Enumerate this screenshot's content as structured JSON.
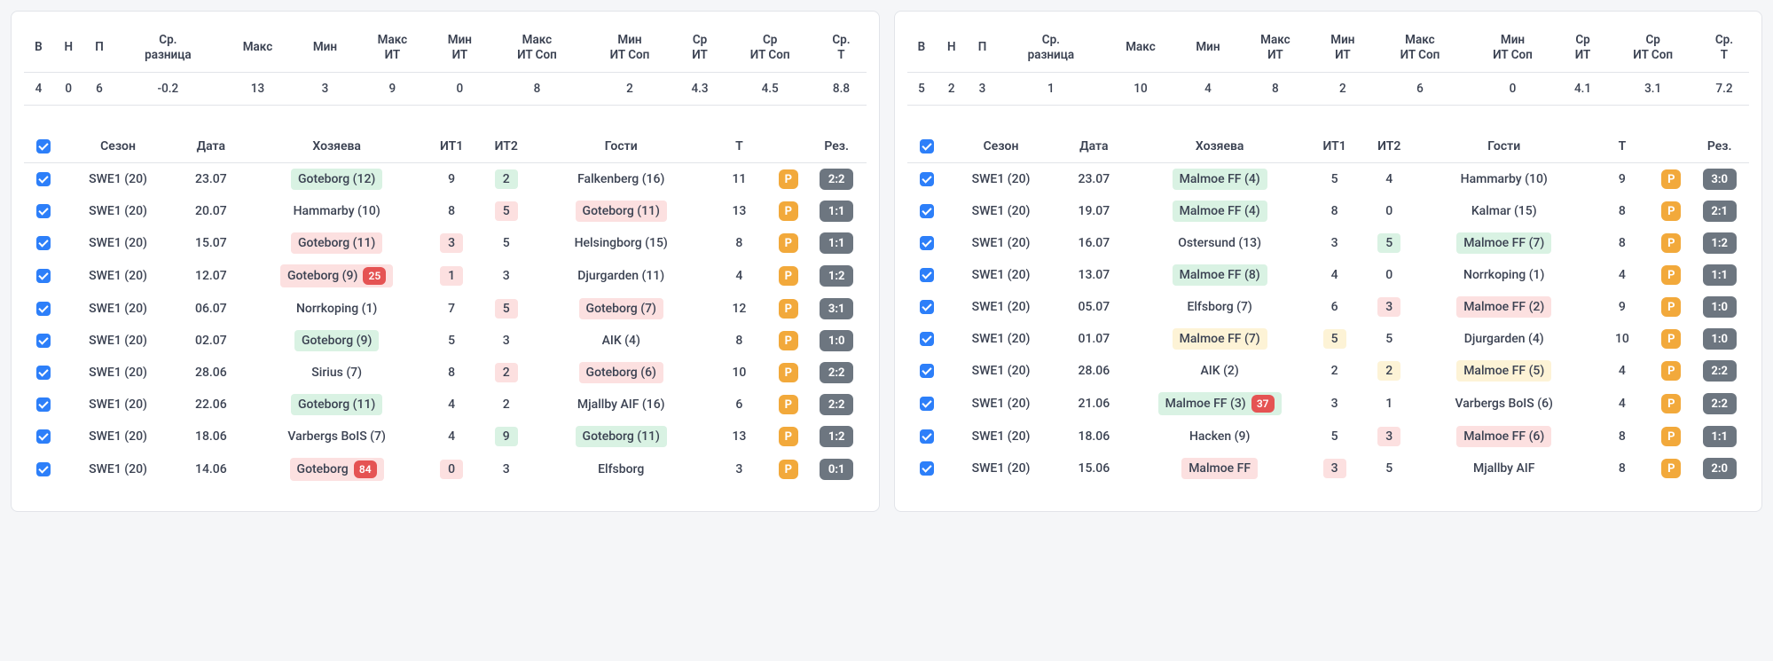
{
  "summary_headers": [
    "В",
    "Н",
    "П",
    "Ср. разница",
    "Макс",
    "Мин",
    "Макс ИТ",
    "Мин ИТ",
    "Макс ИТ Соп",
    "Мин ИТ Соп",
    "Ср ИТ",
    "Ср ИТ Соп",
    "Ср. Т"
  ],
  "match_headers": {
    "season": "Сезон",
    "date": "Дата",
    "home": "Хозяева",
    "it1": "ИТ1",
    "it2": "ИТ2",
    "away": "Гости",
    "t": "Т",
    "res": "Рез."
  },
  "p_label": "Р",
  "left": {
    "summary": [
      "4",
      "0",
      "6",
      "-0.2",
      "13",
      "3",
      "9",
      "0",
      "8",
      "2",
      "4.3",
      "4.5",
      "8.8"
    ],
    "matches": [
      {
        "season": "SWE1 (20)",
        "date": "23.07",
        "home": "Goteborg (12)",
        "home_hl": "green",
        "home_badge": "",
        "it1": "9",
        "it1_hl": "",
        "it2": "2",
        "it2_hl": "green",
        "away": "Falkenberg (16)",
        "away_hl": "",
        "t": "11",
        "res": "2:2"
      },
      {
        "season": "SWE1 (20)",
        "date": "20.07",
        "home": "Hammarby (10)",
        "home_hl": "",
        "home_badge": "",
        "it1": "8",
        "it1_hl": "",
        "it2": "5",
        "it2_hl": "red",
        "away": "Goteborg (11)",
        "away_hl": "red",
        "t": "13",
        "res": "1:1"
      },
      {
        "season": "SWE1 (20)",
        "date": "15.07",
        "home": "Goteborg (11)",
        "home_hl": "red",
        "home_badge": "",
        "it1": "3",
        "it1_hl": "red",
        "it2": "5",
        "it2_hl": "",
        "away": "Helsingborg (15)",
        "away_hl": "",
        "t": "8",
        "res": "1:1"
      },
      {
        "season": "SWE1 (20)",
        "date": "12.07",
        "home": "Goteborg (9)",
        "home_hl": "red",
        "home_badge": "25",
        "it1": "1",
        "it1_hl": "red",
        "it2": "3",
        "it2_hl": "",
        "away": "Djurgarden (11)",
        "away_hl": "",
        "t": "4",
        "res": "1:2"
      },
      {
        "season": "SWE1 (20)",
        "date": "06.07",
        "home": "Norrkoping (1)",
        "home_hl": "",
        "home_badge": "",
        "it1": "7",
        "it1_hl": "",
        "it2": "5",
        "it2_hl": "red",
        "away": "Goteborg (7)",
        "away_hl": "red",
        "t": "12",
        "res": "3:1"
      },
      {
        "season": "SWE1 (20)",
        "date": "02.07",
        "home": "Goteborg (9)",
        "home_hl": "green",
        "home_badge": "",
        "it1": "5",
        "it1_hl": "",
        "it2": "3",
        "it2_hl": "",
        "away": "AIK (4)",
        "away_hl": "",
        "t": "8",
        "res": "1:0"
      },
      {
        "season": "SWE1 (20)",
        "date": "28.06",
        "home": "Sirius (7)",
        "home_hl": "",
        "home_badge": "",
        "it1": "8",
        "it1_hl": "",
        "it2": "2",
        "it2_hl": "red",
        "away": "Goteborg (6)",
        "away_hl": "red",
        "t": "10",
        "res": "2:2"
      },
      {
        "season": "SWE1 (20)",
        "date": "22.06",
        "home": "Goteborg (11)",
        "home_hl": "green",
        "home_badge": "",
        "it1": "4",
        "it1_hl": "",
        "it2": "2",
        "it2_hl": "",
        "away": "Mjallby AIF (16)",
        "away_hl": "",
        "t": "6",
        "res": "2:2"
      },
      {
        "season": "SWE1 (20)",
        "date": "18.06",
        "home": "Varbergs BoIS (7)",
        "home_hl": "",
        "home_badge": "",
        "it1": "4",
        "it1_hl": "",
        "it2": "9",
        "it2_hl": "green",
        "away": "Goteborg (11)",
        "away_hl": "green",
        "t": "13",
        "res": "1:2"
      },
      {
        "season": "SWE1 (20)",
        "date": "14.06",
        "home": "Goteborg",
        "home_hl": "red",
        "home_badge": "84",
        "it1": "0",
        "it1_hl": "red",
        "it2": "3",
        "it2_hl": "",
        "away": "Elfsborg",
        "away_hl": "",
        "t": "3",
        "res": "0:1"
      }
    ]
  },
  "right": {
    "summary": [
      "5",
      "2",
      "3",
      "1",
      "10",
      "4",
      "8",
      "2",
      "6",
      "0",
      "4.1",
      "3.1",
      "7.2"
    ],
    "matches": [
      {
        "season": "SWE1 (20)",
        "date": "23.07",
        "home": "Malmoe FF (4)",
        "home_hl": "green",
        "home_badge": "",
        "it1": "5",
        "it1_hl": "",
        "it2": "4",
        "it2_hl": "",
        "away": "Hammarby (10)",
        "away_hl": "",
        "t": "9",
        "res": "3:0"
      },
      {
        "season": "SWE1 (20)",
        "date": "19.07",
        "home": "Malmoe FF (4)",
        "home_hl": "green",
        "home_badge": "",
        "it1": "8",
        "it1_hl": "",
        "it2": "0",
        "it2_hl": "",
        "away": "Kalmar (15)",
        "away_hl": "",
        "t": "8",
        "res": "2:1"
      },
      {
        "season": "SWE1 (20)",
        "date": "16.07",
        "home": "Ostersund (13)",
        "home_hl": "",
        "home_badge": "",
        "it1": "3",
        "it1_hl": "",
        "it2": "5",
        "it2_hl": "green",
        "away": "Malmoe FF (7)",
        "away_hl": "green",
        "t": "8",
        "res": "1:2"
      },
      {
        "season": "SWE1 (20)",
        "date": "13.07",
        "home": "Malmoe FF (8)",
        "home_hl": "green",
        "home_badge": "",
        "it1": "4",
        "it1_hl": "",
        "it2": "0",
        "it2_hl": "",
        "away": "Norrkoping (1)",
        "away_hl": "",
        "t": "4",
        "res": "1:1"
      },
      {
        "season": "SWE1 (20)",
        "date": "05.07",
        "home": "Elfsborg (7)",
        "home_hl": "",
        "home_badge": "",
        "it1": "6",
        "it1_hl": "",
        "it2": "3",
        "it2_hl": "red",
        "away": "Malmoe FF (2)",
        "away_hl": "red",
        "t": "9",
        "res": "1:0"
      },
      {
        "season": "SWE1 (20)",
        "date": "01.07",
        "home": "Malmoe FF (7)",
        "home_hl": "yellow",
        "home_badge": "",
        "it1": "5",
        "it1_hl": "yellow",
        "it2": "5",
        "it2_hl": "",
        "away": "Djurgarden (4)",
        "away_hl": "",
        "t": "10",
        "res": "1:0"
      },
      {
        "season": "SWE1 (20)",
        "date": "28.06",
        "home": "AIK (2)",
        "home_hl": "",
        "home_badge": "",
        "it1": "2",
        "it1_hl": "",
        "it2": "2",
        "it2_hl": "yellow",
        "away": "Malmoe FF (5)",
        "away_hl": "yellow",
        "t": "4",
        "res": "2:2"
      },
      {
        "season": "SWE1 (20)",
        "date": "21.06",
        "home": "Malmoe FF (3)",
        "home_hl": "green",
        "home_badge": "37",
        "it1": "3",
        "it1_hl": "",
        "it2": "1",
        "it2_hl": "",
        "away": "Varbergs BoIS (6)",
        "away_hl": "",
        "t": "4",
        "res": "2:2"
      },
      {
        "season": "SWE1 (20)",
        "date": "18.06",
        "home": "Hacken (9)",
        "home_hl": "",
        "home_badge": "",
        "it1": "5",
        "it1_hl": "",
        "it2": "3",
        "it2_hl": "red",
        "away": "Malmoe FF (6)",
        "away_hl": "red",
        "t": "8",
        "res": "1:1"
      },
      {
        "season": "SWE1 (20)",
        "date": "15.06",
        "home": "Malmoe FF",
        "home_hl": "red",
        "home_badge": "",
        "it1": "3",
        "it1_hl": "red",
        "it2": "5",
        "it2_hl": "",
        "away": "Mjallby AIF",
        "away_hl": "",
        "t": "8",
        "res": "2:0"
      }
    ]
  }
}
